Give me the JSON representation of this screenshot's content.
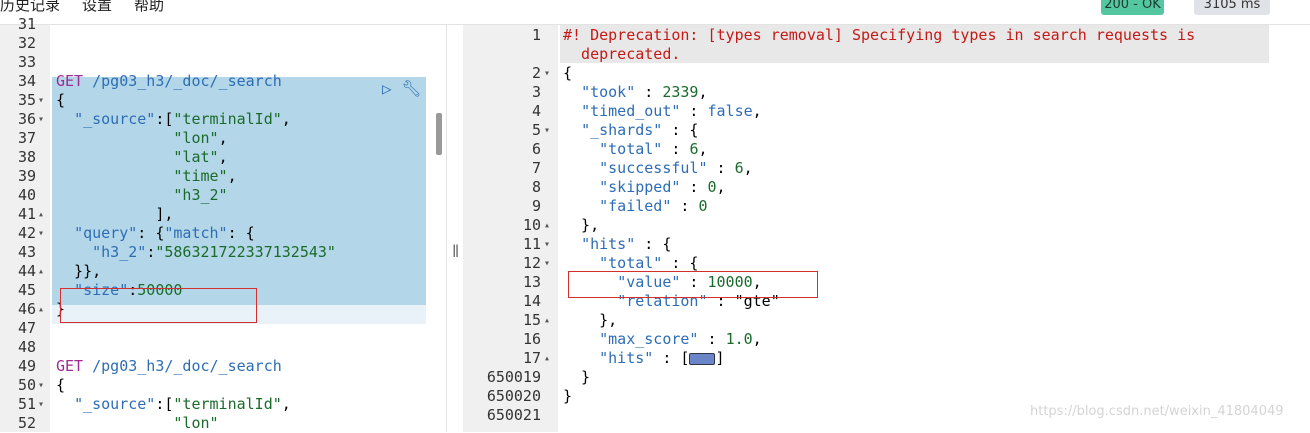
{
  "menu": [
    "历史记录",
    "设置",
    "帮助"
  ],
  "status": {
    "code": "200 - OK",
    "time": "3105 ms"
  },
  "left_lines": [
    {
      "n": "31",
      "t": ""
    },
    {
      "n": "32",
      "t": ""
    },
    {
      "n": "33",
      "t": ""
    },
    {
      "n": "34",
      "t": "GET /pg03_h3/_doc/_search"
    },
    {
      "n": "35",
      "t": "{"
    },
    {
      "n": "36",
      "t": "  \"_source\":[\"terminalId\","
    },
    {
      "n": "37",
      "t": "             \"lon\","
    },
    {
      "n": "38",
      "t": "             \"lat\","
    },
    {
      "n": "39",
      "t": "             \"time\","
    },
    {
      "n": "40",
      "t": "             \"h3_2\""
    },
    {
      "n": "41",
      "t": "           ],"
    },
    {
      "n": "42",
      "t": "  \"query\": {\"match\": {"
    },
    {
      "n": "43",
      "t": "    \"h3_2\":\"586321722337132543\""
    },
    {
      "n": "44",
      "t": "  }},"
    },
    {
      "n": "45",
      "t": "  \"size\":50000"
    },
    {
      "n": "46",
      "t": "}"
    },
    {
      "n": "47",
      "t": ""
    },
    {
      "n": "48",
      "t": ""
    },
    {
      "n": "49",
      "t": "GET /pg03_h3/_doc/_search"
    },
    {
      "n": "50",
      "t": "{"
    },
    {
      "n": "51",
      "t": "  \"_source\":[\"terminalId\","
    },
    {
      "n": "52",
      "t": "             \"lon\""
    }
  ],
  "right_lines": [
    {
      "n": "1",
      "t": "#! Deprecation: [types removal] Specifying types in search requests is"
    },
    {
      "n": "",
      "t": "  deprecated."
    },
    {
      "n": "2",
      "t": "{"
    },
    {
      "n": "3",
      "t": "  \"took\" : 2339,"
    },
    {
      "n": "4",
      "t": "  \"timed_out\" : false,"
    },
    {
      "n": "5",
      "t": "  \"_shards\" : {"
    },
    {
      "n": "6",
      "t": "    \"total\" : 6,"
    },
    {
      "n": "7",
      "t": "    \"successful\" : 6,"
    },
    {
      "n": "8",
      "t": "    \"skipped\" : 0,"
    },
    {
      "n": "9",
      "t": "    \"failed\" : 0"
    },
    {
      "n": "10",
      "t": "  },"
    },
    {
      "n": "11",
      "t": "  \"hits\" : {"
    },
    {
      "n": "12",
      "t": "    \"total\" : {"
    },
    {
      "n": "13",
      "t": "      \"value\" : 10000,"
    },
    {
      "n": "14",
      "t": "      \"relation\" : \"gte\""
    },
    {
      "n": "15",
      "t": "    },"
    },
    {
      "n": "16",
      "t": "    \"max_score\" : 1.0,"
    },
    {
      "n": "17",
      "t": "    \"hits\" : ["
    },
    {
      "n": "650019",
      "t": "  }"
    },
    {
      "n": "650020",
      "t": "}"
    },
    {
      "n": "650021",
      "t": ""
    }
  ],
  "watermark": "https://blog.csdn.net/weixin_41804049",
  "hits_collapsed_close": "]"
}
